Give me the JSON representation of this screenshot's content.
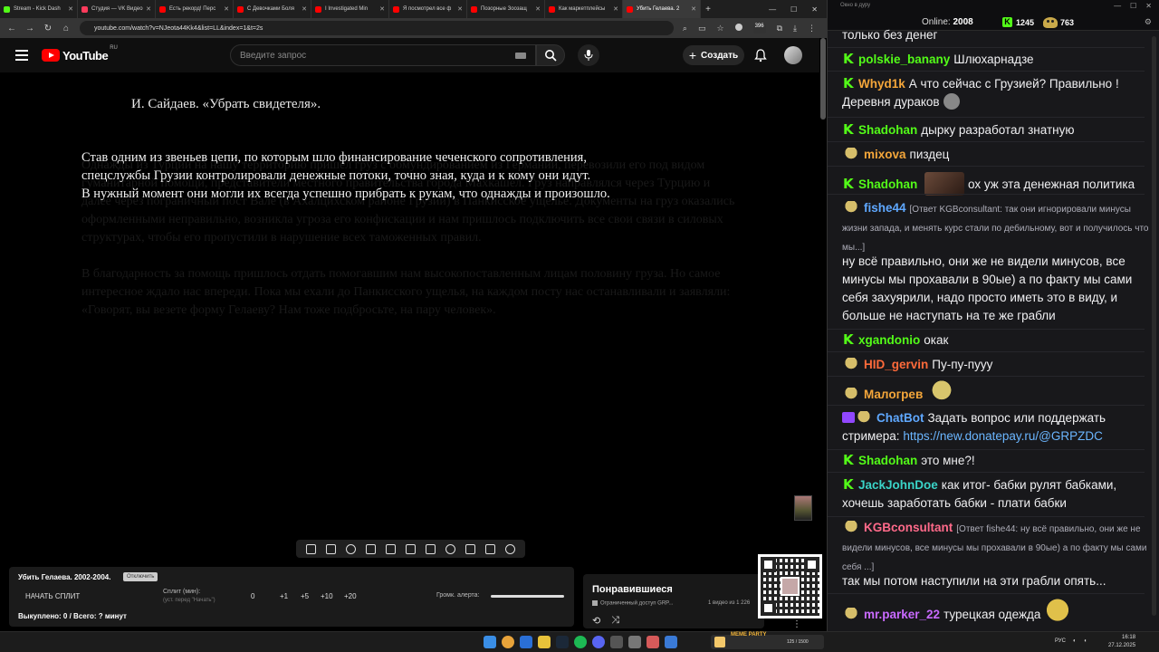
{
  "browser": {
    "tabs": [
      {
        "label": "Stream - Kick Dash",
        "color": "#53fc18"
      },
      {
        "label": "Студия — VK Видео",
        "color": "#ff3b5c"
      },
      {
        "label": "Есть рекорд! Перс",
        "color": "#ff0000"
      },
      {
        "label": "С Девочками Боля",
        "color": "#ff0000"
      },
      {
        "label": "I Investigated Min",
        "color": "#ff0000"
      },
      {
        "label": "Я посмотрел все ф",
        "color": "#ff0000"
      },
      {
        "label": "Позорные Зоозащ",
        "color": "#ff0000"
      },
      {
        "label": "Как маркетплейсы",
        "color": "#ff0000"
      },
      {
        "label": "Убить Гелаева. 2",
        "color": "#ff0000",
        "active": true
      }
    ],
    "url": "youtube.com/watch?v=NJeota44Kk4&list=LL&index=1&t=2s",
    "badge_count": "396"
  },
  "youtube": {
    "logo_text": "YouTube",
    "region": "RU",
    "search_placeholder": "Введите запрос",
    "create_label": "Создать"
  },
  "video": {
    "title": "И. Сайдаев. «Убрать свидетеля».",
    "text_lines": [
      "Став одним из звеньев цепи, по которым шло финансирование чеченского сопротивления,",
      "спецслужбы Грузии контролировали денежные потоки, точно зная, куда и к кому они идут.",
      "В нужный момент они могли их всегда успешно прибрать к рукам, что однажды и произошло."
    ],
    "ghost_paragraphs": [
      "Однажды из Турции на нашу территорию пришел груз с обмундированием из Германии, перевозили его под видом гуманитарной помощи, представители местного правительства города Махкашел. Груз направлялся через Турцию и далее через пограничный пост Вале (в Ахалцихском районе Грузии) в Панкисское ущелье. Документы на груз оказались оформленными неправильно, возникла угроза его конфискации и нам пришлось подключить все свои связи в силовых структурах, чтобы его пропустили в нарушение всех таможенных правил.",
      "В благодарность за помощь пришлось отдать помогавшим нам высокопоставленным лицам половину груза. Но самое интересное ждало нас впереди. Пока мы ехали до Панкисского ущелья, на каждом посту нас останавливали и заявляли: «Говорят, вы везете форму Гелаеву? Нам тоже подбросьте, на пару человек»."
    ]
  },
  "split_panel": {
    "name": "Убить Гелаева. 2002-2004.",
    "badge": "Отключить",
    "start_label": "НАЧАТЬ СПЛИТ",
    "split_min_label": "Сплит (мин):",
    "split_hint": "(уст. перед \"Начать\")",
    "split_value": "0",
    "steps": [
      "+1",
      "+5",
      "+10",
      "+20"
    ],
    "alert_label": "Громк. алерта:",
    "bought_label": "Выкуплено: 0 / Всего: ? минут"
  },
  "liked": {
    "title": "Понравившиеся",
    "access": "Ограниченный доступ  GRP...",
    "count": "1 видео из 1 226"
  },
  "chat": {
    "window_title": "Окно в дуру",
    "online_label": "Online:",
    "online_count": "2008",
    "stat_kick": "1245",
    "stat_other": "763",
    "messages": [
      {
        "user": "",
        "text": "только без денег",
        "color": "#efeff1"
      },
      {
        "user": "polskie_banany",
        "text": "Шлюхарнадзе",
        "color": "#53fc18"
      },
      {
        "user": "Whyd1k",
        "text": "А что сейчас с Грузией? Правильно ! Деревня дураков",
        "color": "#f4a63a"
      },
      {
        "user": "Shadohan",
        "text": "дырку разработал знатную",
        "color": "#53fc18"
      },
      {
        "user": "mixova",
        "text": "пиздец",
        "color": "#f4a63a"
      },
      {
        "user": "Shadohan",
        "text": "ох уж эта денежная политика",
        "color": "#53fc18"
      },
      {
        "user": "fishe44",
        "reply": "[Ответ KGBconsultant: так они игнорировали минусы жизни запада, и менять курс стали по дебильному, вот и получилось что мы...]",
        "text": "ну всё правильно, они же не видели минусов, все минусы мы прохавали в 90ые) а по факту мы сами себя захуярили, надо просто иметь это в виду, и больше не наступать на те же грабли",
        "color": "#5fa8ff"
      },
      {
        "user": "xgandonio",
        "text": "окак",
        "color": "#53fc18"
      },
      {
        "user": "HID_gervin",
        "text": "Пу-пу-пууу",
        "color": "#ff6a3a"
      },
      {
        "user": "Малогрев",
        "text": "",
        "color": "#f4a63a"
      },
      {
        "user": "ChatBot",
        "text": "Задать вопрос или поддержать стримера:",
        "link": "https://new.donatepay.ru/@GRPZDC",
        "color": "#5fa8ff"
      },
      {
        "user": "Shadohan",
        "text": "это мне?!",
        "color": "#53fc18"
      },
      {
        "user": "JackJohnDoe",
        "text": "как итог- бабки рулят бабками, хочешь заработать бабки - плати бабки",
        "color": "#3ad4c8"
      },
      {
        "user": "KGBconsultant",
        "reply": "[Ответ fishe44: ну всё правильно, они же не видели минусов, все минусы мы прохавали в 90ые) а по факту мы сами себя ...]",
        "text": "так мы потом наступили на эти грабли опять...",
        "color": "#ff6a8a"
      },
      {
        "user": "mr.parker_22",
        "text": "турецкая одежда",
        "color": "#c86aff"
      }
    ]
  },
  "taskbar": {
    "widget_title": "MEME PARTY",
    "widget_count": "125 / 1500",
    "lang": "РУС",
    "time": "16:18",
    "date": "27.12.2025"
  }
}
